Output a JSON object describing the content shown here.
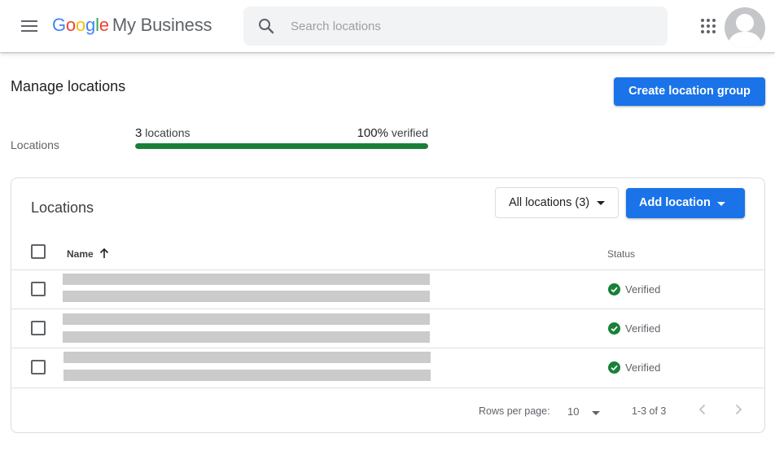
{
  "header": {
    "logo_letters": [
      "G",
      "o",
      "o",
      "g",
      "l",
      "e"
    ],
    "product_name": "My Business",
    "search_placeholder": "Search locations",
    "icons": {
      "menu": "menu-icon",
      "search": "search-icon",
      "apps": "apps-grid-icon",
      "avatar": "account-avatar"
    }
  },
  "summary": {
    "page_title": "Manage locations",
    "create_group_label": "Create location group",
    "label": "Locations",
    "count_number": "3",
    "count_suffix": " locations",
    "verified_percent": "100%",
    "verified_suffix": " verified",
    "progress_fraction": 1.0,
    "progress_color": "#188038"
  },
  "card": {
    "title": "Locations",
    "filter_label": "All locations (3)",
    "add_label": "Add location",
    "columns": {
      "name": "Name",
      "status": "Status"
    },
    "rows": [
      {
        "status": "Verified"
      },
      {
        "status": "Verified"
      },
      {
        "status": "Verified"
      }
    ],
    "rows_per_page_label": "Rows per page:",
    "rows_per_page_value": "10",
    "range_text": "1-3 of 3"
  },
  "colors": {
    "accent": "#1a73e8",
    "verified": "#188038",
    "placeholder_bar": "#cbcbcb"
  }
}
